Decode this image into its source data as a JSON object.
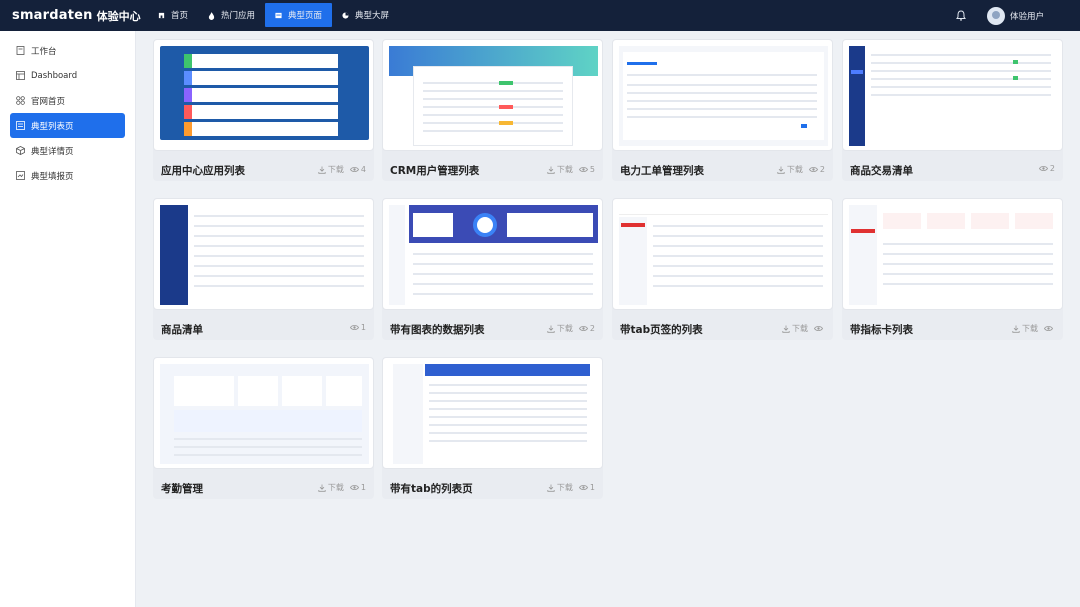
{
  "brand": {
    "logo": "smardaten",
    "subtitle": "体验中心"
  },
  "nav": [
    {
      "label": "首页",
      "icon": "home-icon",
      "active": false
    },
    {
      "label": "热门应用",
      "icon": "fire-icon",
      "active": false
    },
    {
      "label": "典型页面",
      "icon": "page-icon",
      "active": true
    },
    {
      "label": "典型大屏",
      "icon": "screen-icon",
      "active": false
    }
  ],
  "user": {
    "name": "体验用户"
  },
  "sidebar": [
    {
      "label": "工作台",
      "icon": "workbench-icon",
      "active": false
    },
    {
      "label": "Dashboard",
      "icon": "dashboard-icon",
      "active": false
    },
    {
      "label": "官网首页",
      "icon": "grid-icon",
      "active": false
    },
    {
      "label": "典型列表页",
      "icon": "list-icon",
      "active": true
    },
    {
      "label": "典型详情页",
      "icon": "cube-icon",
      "active": false
    },
    {
      "label": "典型填报页",
      "icon": "form-icon",
      "active": false
    }
  ],
  "cards": [
    {
      "name": "应用中心应用列表",
      "download": "下载",
      "views": "4"
    },
    {
      "name": "CRM用户管理列表",
      "download": "下载",
      "views": "5"
    },
    {
      "name": "电力工单管理列表",
      "download": "下载",
      "views": "2"
    },
    {
      "name": "商品交易清单",
      "download": "",
      "views": "2"
    },
    {
      "name": "商品清单",
      "download": "",
      "views": "1"
    },
    {
      "name": "带有图表的数据列表",
      "download": "下载",
      "views": "2"
    },
    {
      "name": "带tab页签的列表",
      "download": "下载",
      "views": ""
    },
    {
      "name": "带指标卡列表",
      "download": "下载",
      "views": ""
    },
    {
      "name": "考勤管理",
      "download": "下载",
      "views": "1"
    },
    {
      "name": "带有tab的列表页",
      "download": "下载",
      "views": "1"
    }
  ],
  "colors": {
    "topbar": "#14213a",
    "accent": "#1f6feb",
    "background": "#eef1f5"
  }
}
